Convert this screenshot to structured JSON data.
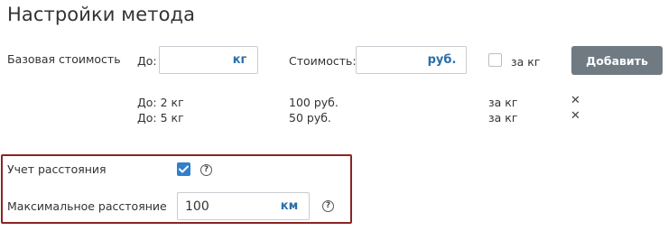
{
  "page": {
    "title": "Настройки метода"
  },
  "base_cost": {
    "label": "Базовая стоимость",
    "to_label": "До:",
    "weight_value": "",
    "weight_unit": "кг",
    "cost_label": "Стоимость:",
    "cost_value": "",
    "cost_unit": "руб.",
    "per_kg_label": "за кг",
    "per_kg_checked": false,
    "add_button": "Добавить"
  },
  "rates": [
    {
      "to": "До: 2 кг",
      "cost": "100 руб.",
      "per": "за кг",
      "delete": "✕"
    },
    {
      "to": "До: 5 кг",
      "cost": "50 руб.",
      "per": "за кг",
      "delete": "✕"
    }
  ],
  "distance": {
    "label": "Учет расстояния",
    "checked": true,
    "help": "?",
    "max_label": "Максимальное расстояние",
    "max_value": "100",
    "max_unit": "км",
    "max_help": "?"
  }
}
